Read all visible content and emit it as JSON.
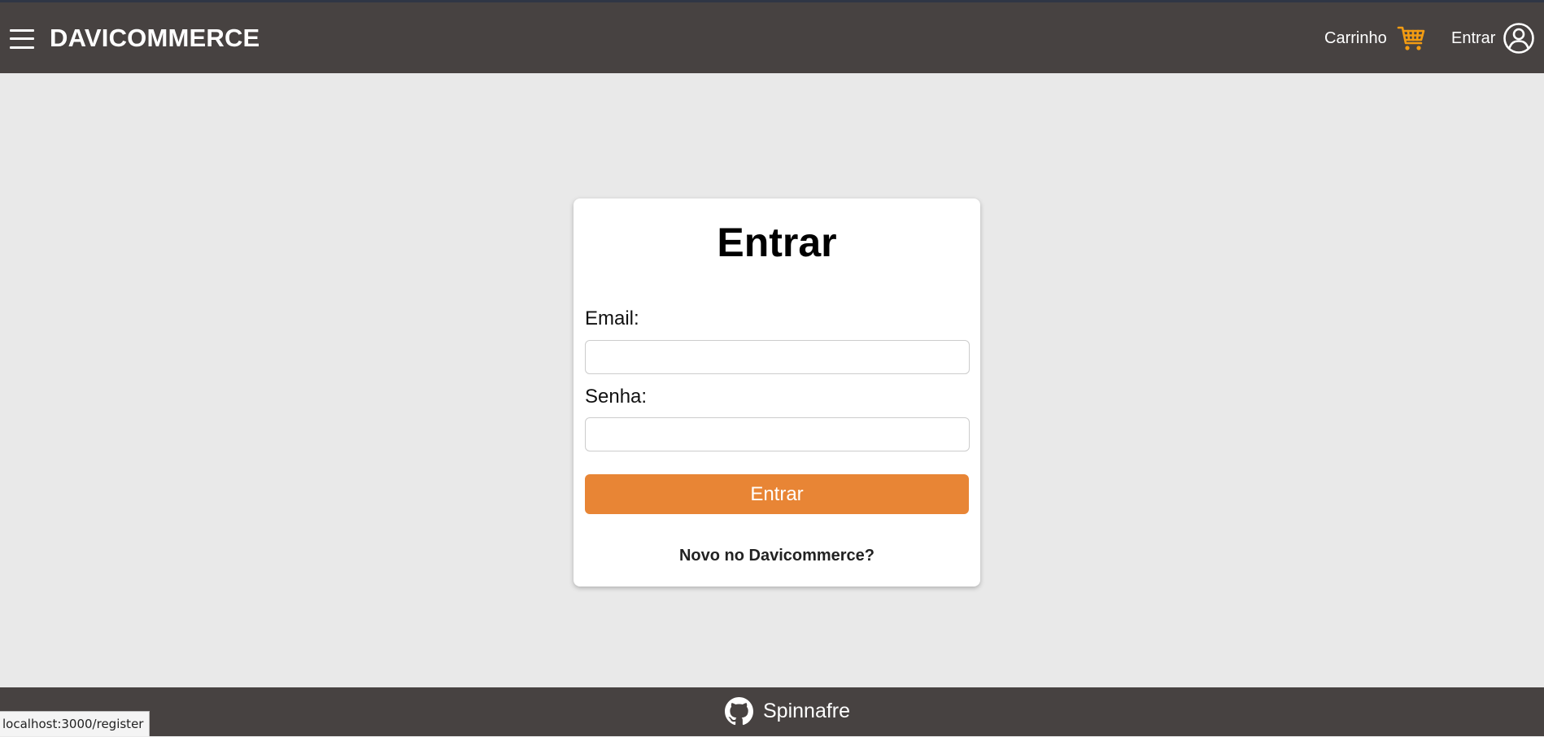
{
  "header": {
    "brand": "DAVICOMMERCE",
    "cart_label": "Carrinho",
    "login_label": "Entrar",
    "icons": {
      "menu": "hamburger-menu-icon",
      "cart": "shopping-cart-icon",
      "user": "user-circle-icon"
    },
    "cart_icon_color": "#f39c12"
  },
  "login_form": {
    "title": "Entrar",
    "email_label": "Email:",
    "email_value": "",
    "password_label": "Senha:",
    "password_value": "",
    "submit_label": "Entrar",
    "register_link": "Novo no Davicommerce?",
    "button_color": "#e88535"
  },
  "footer": {
    "github_label": "Spinnafre",
    "icon": "github-icon"
  },
  "status_bar": {
    "url": "localhost:3000/register"
  },
  "colors": {
    "header_bg": "#474241",
    "page_bg": "#e9e9e9",
    "card_bg": "#ffffff"
  }
}
